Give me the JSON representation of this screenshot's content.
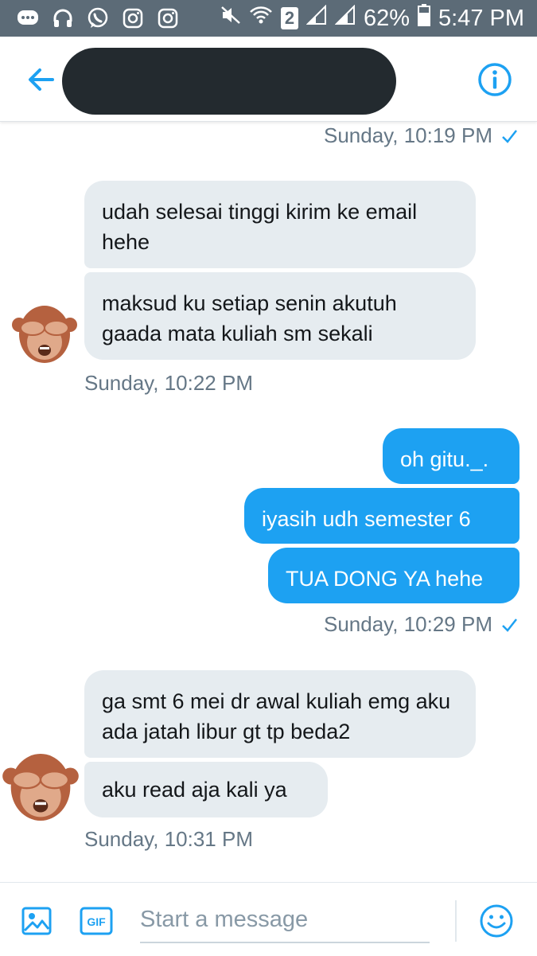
{
  "status_bar": {
    "icons_left": [
      "message-icon",
      "headphones-icon",
      "whatsapp-icon",
      "instagram-icon",
      "instagram-icon"
    ],
    "sim_badge": "2",
    "battery": "62%",
    "time": "5:47 PM"
  },
  "header": {
    "back_icon": "back-arrow-icon",
    "info_icon": "info-icon"
  },
  "messages": [
    {
      "type": "timestamp",
      "side": "out",
      "text": "Sunday, 10:19 PM"
    },
    {
      "type": "bubble",
      "side": "in",
      "text": "udah selesai tinggi kirim ke email hehe"
    },
    {
      "type": "bubble",
      "side": "in",
      "text": "maksud ku setiap senin akutuh gaada mata kuliah sm sekali"
    },
    {
      "type": "timestamp",
      "side": "in",
      "text": "Sunday, 10:22 PM"
    },
    {
      "type": "bubble",
      "side": "out",
      "text": "oh gitu._."
    },
    {
      "type": "bubble",
      "side": "out",
      "text": "iyasih udh semester 6"
    },
    {
      "type": "bubble",
      "side": "out",
      "text": "TUA DONG YA hehe"
    },
    {
      "type": "timestamp",
      "side": "out",
      "text": "Sunday, 10:29 PM"
    },
    {
      "type": "bubble",
      "side": "in",
      "text": "ga smt 6 mei dr awal kuliah emg aku ada jatah libur gt tp beda2"
    },
    {
      "type": "bubble",
      "side": "in",
      "text": "aku read aja kali ya"
    },
    {
      "type": "timestamp",
      "side": "in",
      "text": "Sunday, 10:31 PM"
    }
  ],
  "composer": {
    "placeholder": "Start a message",
    "gif_label": "GIF"
  },
  "colors": {
    "accent": "#1da1f2",
    "incoming_bubble": "#e6ecf0",
    "timestamp": "#657786",
    "status_bar": "#5c6b77"
  }
}
